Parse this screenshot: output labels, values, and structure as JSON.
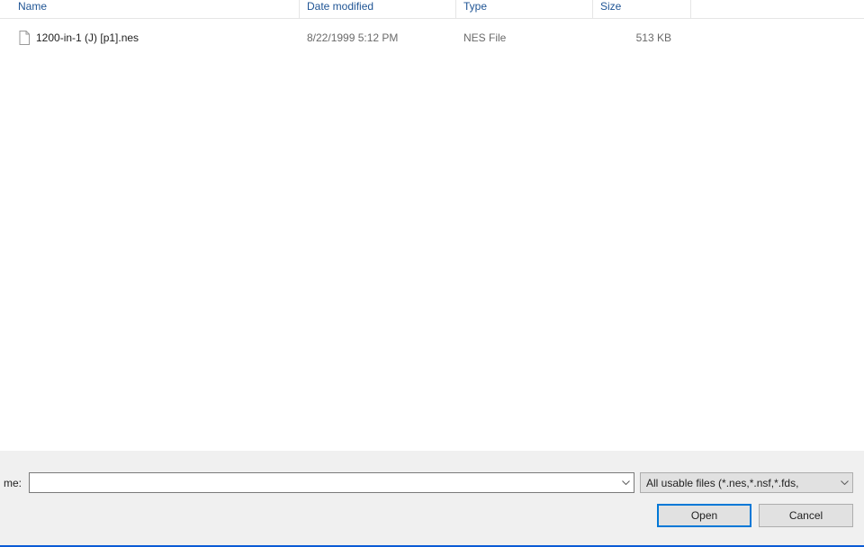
{
  "headers": {
    "name": "Name",
    "date": "Date modified",
    "type": "Type",
    "size": "Size"
  },
  "files": [
    {
      "name": "1200-in-1 (J) [p1].nes",
      "date": "8/22/1999 5:12 PM",
      "type": "NES File",
      "size": "513 KB"
    }
  ],
  "filename": {
    "label": "me:",
    "value": ""
  },
  "filetype": {
    "selected": "All usable files (*.nes,*.nsf,*.fds,"
  },
  "buttons": {
    "open": "Open",
    "cancel": "Cancel"
  }
}
